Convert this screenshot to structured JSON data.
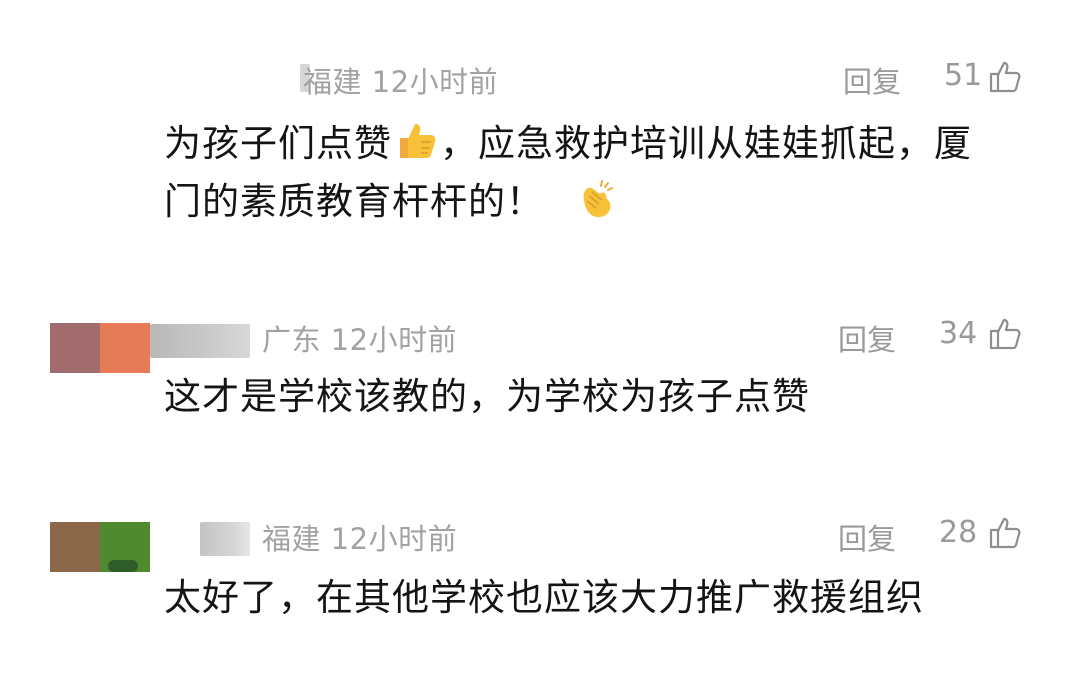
{
  "comments": [
    {
      "location": "福建",
      "time": "12小时前",
      "reply_label": "回复",
      "likes": "51",
      "text_line1_a": "为孩子们点赞",
      "text_line1_b": "，应急救护培训从娃娃抓起，厦",
      "text_line2": "门的素质教育杆杆的！",
      "emoji_1": "thumbs-up-emoji",
      "emoji_2": "clapping-hands-emoji"
    },
    {
      "location": "广东",
      "time": "12小时前",
      "reply_label": "回复",
      "likes": "34",
      "text": "这才是学校该教的，为学校为孩子点赞"
    },
    {
      "location": "福建",
      "time": "12小时前",
      "reply_label": "回复",
      "likes": "28",
      "text": "太好了，在其他学校也应该大力推广救援组织"
    }
  ],
  "colors": {
    "meta_text": "#a2a2a2",
    "body_text": "#141414",
    "emoji_yellow": "#f7c23a"
  }
}
